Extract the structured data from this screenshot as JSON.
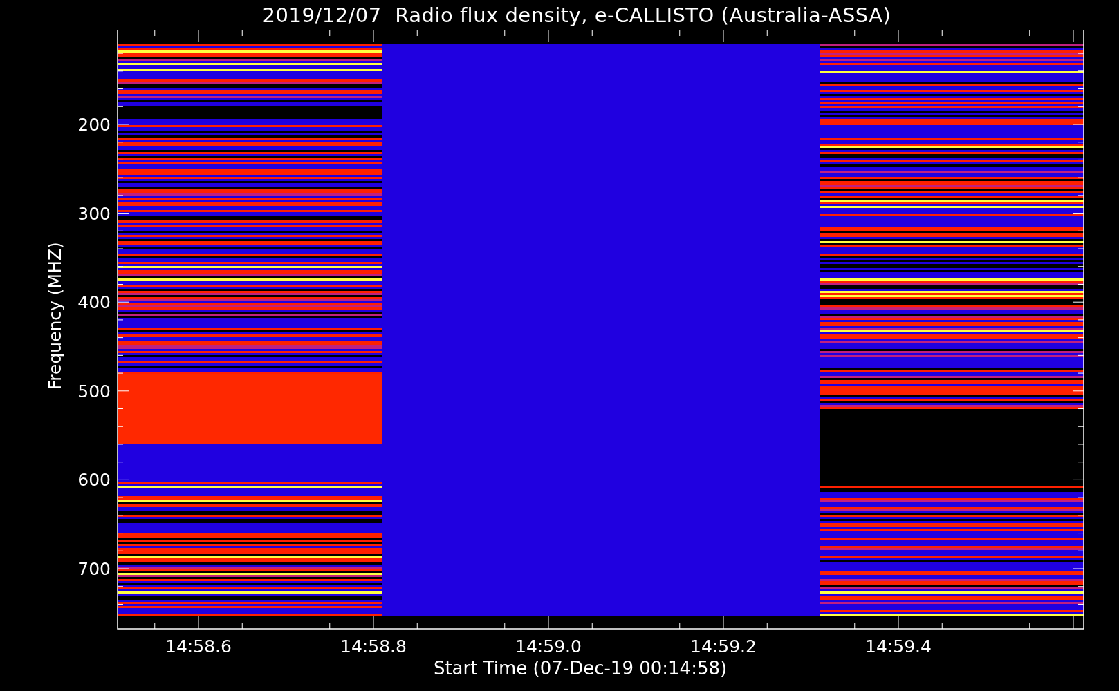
{
  "title": "2019/12/07  Radio flux density, e-CALLISTO (Australia-ASSA)",
  "y_axis": {
    "label": "Frequency (MHZ)",
    "ticks": [
      "200",
      "300",
      "400",
      "500",
      "600",
      "700"
    ]
  },
  "x_axis": {
    "label": "Start Time (07-Dec-19 00:14:58)",
    "ticks": [
      "14:58.6",
      "14:58.8",
      "14:59.0",
      "14:59.2",
      "14:59.4"
    ]
  }
}
